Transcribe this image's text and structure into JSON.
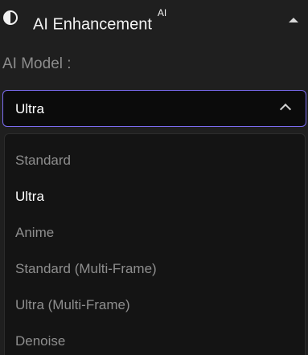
{
  "header": {
    "title": "AI Enhancement",
    "badge": "AI",
    "icon": "contrast-half-circle-icon",
    "collapse_icon": "collapse-triangle-up-icon"
  },
  "ai_model": {
    "label": "AI Model :",
    "selected": "Ultra",
    "accent_color": "#7b6cf0",
    "options": [
      {
        "label": "Standard",
        "selected": false
      },
      {
        "label": "Ultra",
        "selected": true
      },
      {
        "label": "Anime",
        "selected": false
      },
      {
        "label": "Standard (Multi-Frame)",
        "selected": false
      },
      {
        "label": "Ultra (Multi-Frame)",
        "selected": false
      },
      {
        "label": "Denoise",
        "selected": false
      }
    ]
  }
}
